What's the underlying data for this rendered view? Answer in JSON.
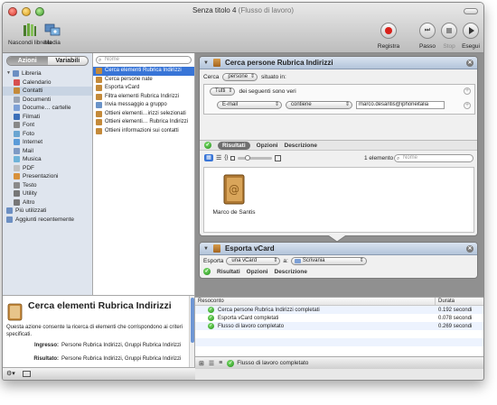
{
  "window": {
    "title": "Senza titolo 4",
    "subtitle": "(Flusso di lavoro)"
  },
  "toolbar": {
    "hide_library": "Nascondi libreria",
    "media": "Media",
    "record": "Registra",
    "step": "Passo",
    "stop": "Stop",
    "run": "Esegui"
  },
  "library": {
    "tab_actions": "Azioni",
    "tab_variables": "Variabili",
    "items": [
      {
        "label": "Libreria",
        "icon": "library-folder-icon",
        "color": "#6c8fc2"
      },
      {
        "label": "Calendario",
        "icon": "calendar-icon",
        "color": "#d75050"
      },
      {
        "label": "Contatti",
        "icon": "contacts-icon",
        "color": "#c48a3a"
      },
      {
        "label": "Documenti",
        "icon": "documents-icon",
        "color": "#9aa4b4"
      },
      {
        "label": "Docume… cartelle",
        "icon": "folder-icon",
        "color": "#7da0d6"
      },
      {
        "label": "Filmati",
        "icon": "movies-icon",
        "color": "#3b6fb9"
      },
      {
        "label": "Font",
        "icon": "font-icon",
        "color": "#888888"
      },
      {
        "label": "Foto",
        "icon": "photo-icon",
        "color": "#6aa5d1"
      },
      {
        "label": "Internet",
        "icon": "internet-icon",
        "color": "#5b9bd8"
      },
      {
        "label": "Mail",
        "icon": "mail-icon",
        "color": "#7e9ac4"
      },
      {
        "label": "Musica",
        "icon": "music-icon",
        "color": "#6fb3d8"
      },
      {
        "label": "PDF",
        "icon": "pdf-icon",
        "color": "#c0c0c0"
      },
      {
        "label": "Presentazioni",
        "icon": "presentation-icon",
        "color": "#d8913b"
      },
      {
        "label": "Testo",
        "icon": "text-icon",
        "color": "#8a8a8a"
      },
      {
        "label": "Utility",
        "icon": "utility-icon",
        "color": "#777777"
      },
      {
        "label": "Altro",
        "icon": "other-icon",
        "color": "#777777"
      },
      {
        "label": "Più utilizzati",
        "icon": "most-used-folder-icon",
        "color": "#6c8fc2"
      },
      {
        "label": "Aggiunti recentemente",
        "icon": "recent-folder-icon",
        "color": "#6c8fc2"
      }
    ]
  },
  "actions": {
    "search_placeholder": "Nome",
    "items": [
      "Cerca elementi Rubrica Indirizzi",
      "Cerca persone nate",
      "Esporta vCard",
      "Filtra elementi Rubrica Indirizzi",
      "Invia messaggio a gruppo",
      "Ottieni elementi…irizzi selezionati",
      "Ottieni elementi… Rubrica Indirizzi",
      "Ottieni informazioni sui contatti"
    ]
  },
  "description": {
    "title": "Cerca elementi Rubrica Indirizzi",
    "text": "Questa azione consente la ricerca di elementi che corrispondono ai criteri specificati.",
    "input_label": "Ingresso:",
    "input_value": "Persone Rubrica Indirizzi, Gruppi Rubrica Indirizzi",
    "result_label": "Risultato:",
    "result_value": "Persone Rubrica Indirizzi, Gruppi Rubrica Indirizzi"
  },
  "panel1": {
    "title": "Cerca persone Rubrica Indirizzi",
    "find_label": "Cerca",
    "find_value": "persone",
    "where_label": "situato in:",
    "match_value": "Tutti",
    "match_suffix": "dei seguenti sono veri",
    "field_value": "E-mail",
    "op_value": "contiene",
    "query_value": "marco.desantis@iphoneitalia",
    "tab_results": "Risultati",
    "tab_options": "Opzioni",
    "tab_description": "Descrizione",
    "count": "1 elemento",
    "results_search_placeholder": "Nome",
    "item_name": "Marco de Santis"
  },
  "panel2": {
    "title": "Esporta vCard",
    "export_label": "Esporta",
    "export_value": "una vCard",
    "to_label": "a:",
    "to_value": "Scrivania",
    "tab_results": "Risultati",
    "tab_options": "Opzioni",
    "tab_description": "Descrizione"
  },
  "log": {
    "col_log": "Resoconto",
    "col_duration": "Durata",
    "rows": [
      {
        "text": "Cerca persone Rubrica Indirizzi completati",
        "duration": "0.192 secondi"
      },
      {
        "text": "Esporta vCard completati",
        "duration": "0.078 secondi"
      },
      {
        "text": "Flusso di lavoro completato",
        "duration": "0.269 secondi"
      }
    ],
    "status": "Flusso di lavoro completato"
  }
}
